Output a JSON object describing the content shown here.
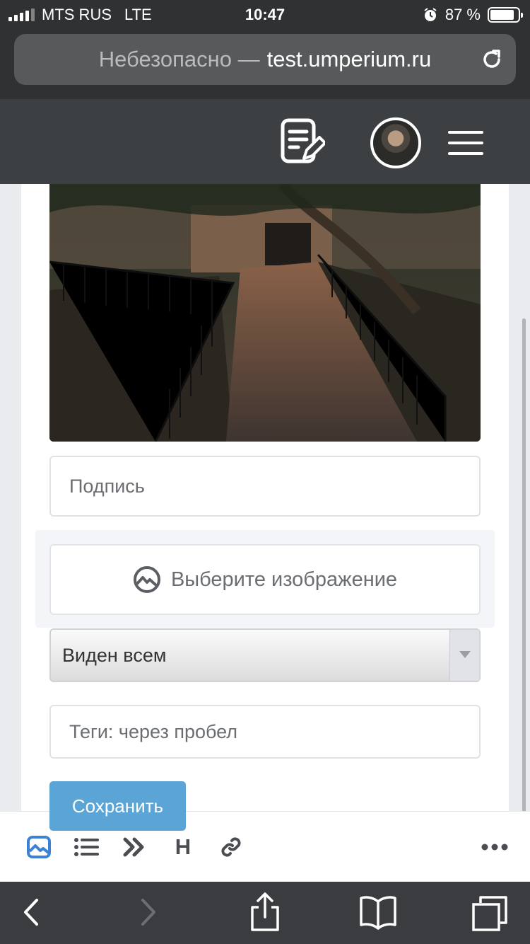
{
  "status_bar": {
    "carrier": "MTS RUS",
    "network": "LTE",
    "time": "10:47",
    "battery_text": "87 %",
    "battery_level": 0.87
  },
  "address_bar": {
    "security_label": "Небезопасно —",
    "domain": "test.umperium.ru",
    "reload_icon": "reload-icon"
  },
  "header": {
    "edit_icon": "edit-post-icon",
    "avatar": "user-avatar",
    "menu_icon": "hamburger-menu-icon"
  },
  "form": {
    "caption_placeholder": "Подпись",
    "upload_label": "Выберите изображение",
    "visibility_value": "Виден всем",
    "tags_placeholder": "Теги: через пробел",
    "save_label": "Сохранить"
  },
  "editor_toolbar": {
    "heading_label": "H",
    "tools": [
      "image-icon",
      "list-icon",
      "quote-icon",
      "heading-icon",
      "link-icon",
      "more-icon"
    ],
    "active_color": "#3b82d6"
  },
  "safari_toolbar": {
    "items": [
      "back-icon",
      "forward-icon",
      "share-icon",
      "bookmarks-icon",
      "tabs-icon"
    ]
  },
  "colors": {
    "accent": "#5ba4d6",
    "header_bg": "#3d4043"
  }
}
